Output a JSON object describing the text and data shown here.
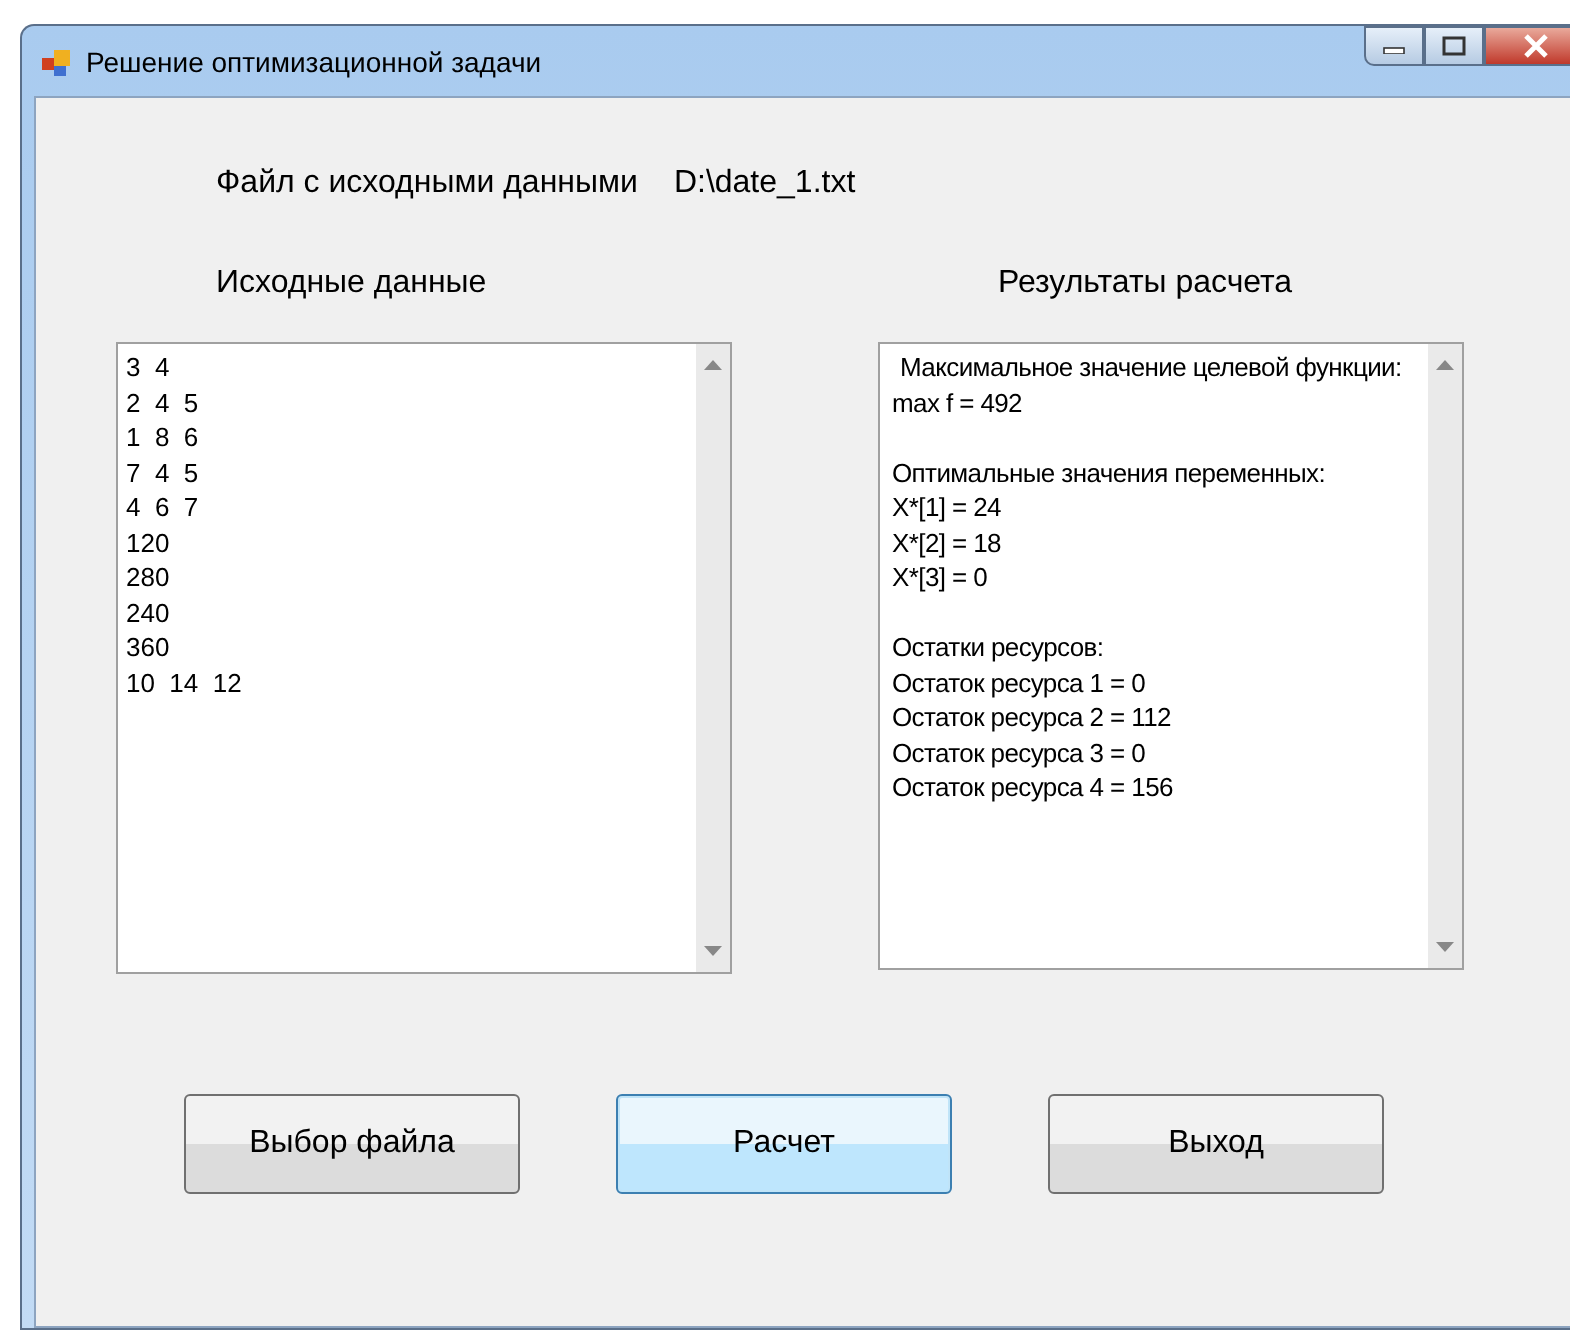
{
  "window": {
    "title": "Решение оптимизационной задачи"
  },
  "file": {
    "label": "Файл с исходными данными",
    "path": "D:\\date_1.txt"
  },
  "input": {
    "heading": "Исходные данные",
    "lines": [
      "3  4",
      "2  4  5",
      "1  8  6",
      "7  4  5",
      "4  6  7",
      "120",
      "280",
      "240",
      "360",
      "10  14  12"
    ]
  },
  "results": {
    "heading": "Результаты расчета",
    "blocks": [
      [
        "Максимальное значение целевой функции:",
        "max f = 492"
      ],
      [
        "Оптимальные значения переменных:",
        "X*[1] = 24",
        "X*[2] = 18",
        "X*[3] = 0"
      ],
      [
        "Остатки ресурсов:",
        "Остаток ресурса 1 = 0",
        "Остаток ресурса 2 = 112",
        "Остаток ресурса 3 = 0",
        "Остаток ресурса 4 = 156"
      ]
    ]
  },
  "buttons": [
    {
      "label": "Выбор файла",
      "selected": false
    },
    {
      "label": "Расчет",
      "selected": true
    },
    {
      "label": "Выход",
      "selected": false
    }
  ]
}
